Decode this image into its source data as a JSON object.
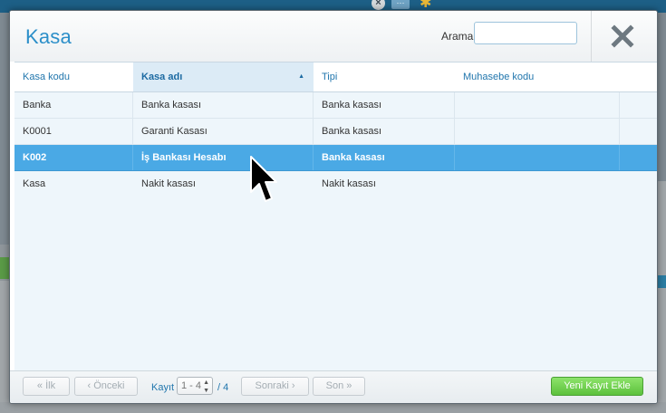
{
  "modal": {
    "title": "Kasa",
    "search": {
      "label": "Arama",
      "value": "",
      "placeholder": ""
    }
  },
  "table": {
    "columns": [
      {
        "label": "Kasa kodu",
        "sorted": false
      },
      {
        "label": "Kasa adı",
        "sorted": true,
        "sort_direction": "ascending"
      },
      {
        "label": "Tipi",
        "sorted": false
      },
      {
        "label": "Muhasebe kodu",
        "sorted": false
      }
    ],
    "rows": [
      {
        "code": "Banka",
        "name": "Banka kasası",
        "type": "Banka kasası",
        "account": "",
        "selected": false
      },
      {
        "code": "K0001",
        "name": "Garanti Kasası",
        "type": "Banka kasası",
        "account": "",
        "selected": false
      },
      {
        "code": "K002",
        "name": "İş Bankası Hesabı",
        "type": "Banka kasası",
        "account": "",
        "selected": true
      },
      {
        "code": "Kasa",
        "name": "Nakit kasası",
        "type": "Nakit kasası",
        "account": "",
        "selected": false
      }
    ]
  },
  "pagination": {
    "first_label": "« İlk",
    "prev_label": "‹ Önceki",
    "page_label": "Kayıt",
    "page_value": "1 - 4",
    "total_label": "/ 4",
    "next_label": "Sonraki ›",
    "last_label": "Son »"
  },
  "actions": {
    "add_label": "Yeni Kayıt Ekle"
  },
  "icons": {
    "close": "close-icon",
    "sort": "sort-ascending-icon",
    "cursor": "mouse-pointer-icon"
  },
  "colors": {
    "accent": "#2c8fc9",
    "selected_row": "#4aa9e5",
    "add_button": "#5cc13c",
    "row_background": "#eef6fb"
  }
}
